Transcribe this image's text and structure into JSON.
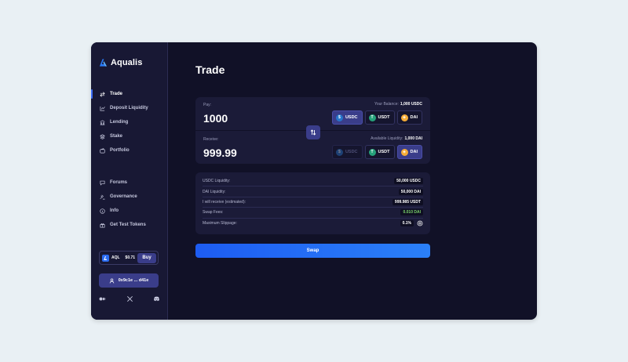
{
  "brand": {
    "name": "Aqualis",
    "accent": "#2a6bf0"
  },
  "sidebar": {
    "nav_primary": [
      {
        "label": "Trade",
        "icon": "arrows-swap-icon",
        "active": true
      },
      {
        "label": "Deposit Liquidity",
        "icon": "chart-icon",
        "active": false
      },
      {
        "label": "Lending",
        "icon": "bank-icon",
        "active": false
      },
      {
        "label": "Stake",
        "icon": "layers-icon",
        "active": false
      },
      {
        "label": "Portfolio",
        "icon": "wallet-icon",
        "active": false
      }
    ],
    "nav_secondary": [
      {
        "label": "Forums",
        "icon": "chat-icon"
      },
      {
        "label": "Governance",
        "icon": "gavel-icon"
      },
      {
        "label": "Info",
        "icon": "info-icon"
      },
      {
        "label": "Get Test Tokens",
        "icon": "gift-icon"
      }
    ],
    "token": {
      "symbol": "AQL",
      "price": "$0.71",
      "buy_label": "Buy"
    },
    "wallet": {
      "address": "0x9c1e ... d41e"
    },
    "socials": [
      "medium-icon",
      "x-icon",
      "discord-icon"
    ]
  },
  "main": {
    "title": "Trade",
    "pay": {
      "label": "Pay:",
      "amount": "1000",
      "info_label": "Your Balance:",
      "info_value": "1,000 USDC",
      "tokens": [
        {
          "symbol": "USDC",
          "color": "#2775ca",
          "state": "selected"
        },
        {
          "symbol": "USDT",
          "color": "#26a17b",
          "state": "normal"
        },
        {
          "symbol": "DAI",
          "color": "#f5ac37",
          "state": "normal"
        }
      ]
    },
    "receive": {
      "label": "Receive:",
      "amount": "999.99",
      "info_label": "Available Liquidity:",
      "info_value": "1,000 DAI",
      "tokens": [
        {
          "symbol": "USDC",
          "color": "#2775ca",
          "state": "disabled"
        },
        {
          "symbol": "USDT",
          "color": "#26a17b",
          "state": "normal"
        },
        {
          "symbol": "DAI",
          "color": "#f5ac37",
          "state": "selected"
        }
      ]
    },
    "details": [
      {
        "label": "USDC Liquidity:",
        "value": "50,000 USDC",
        "tone": "normal"
      },
      {
        "label": "DAI Liquidity:",
        "value": "50,000 DAI",
        "tone": "normal"
      },
      {
        "label": "I will receive (estimated):",
        "value": "999.985 USDT",
        "tone": "normal"
      },
      {
        "label": "Swap Fees:",
        "value": "0.010 DAI",
        "tone": "green"
      },
      {
        "label": "Maximum Slippage:",
        "value": "0.1%",
        "tone": "normal"
      }
    ],
    "swap_label": "Swap"
  }
}
